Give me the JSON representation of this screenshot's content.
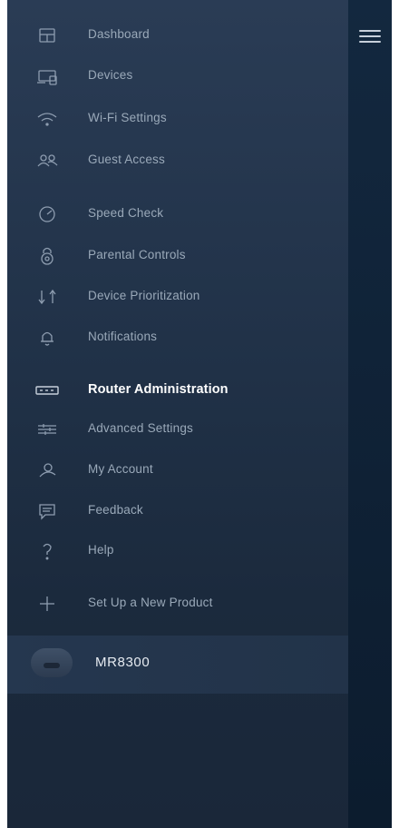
{
  "menu": {
    "items": [
      {
        "label": "Dashboard",
        "icon": "dashboard-icon"
      },
      {
        "label": "Devices",
        "icon": "devices-icon"
      },
      {
        "label": "Wi-Fi Settings",
        "icon": "wifi-icon"
      },
      {
        "label": "Guest Access",
        "icon": "guest-access-icon"
      },
      {
        "label": "Speed Check",
        "icon": "speedometer-icon"
      },
      {
        "label": "Parental Controls",
        "icon": "lock-icon"
      },
      {
        "label": "Device Prioritization",
        "icon": "priority-arrows-icon"
      },
      {
        "label": "Notifications",
        "icon": "bell-icon"
      },
      {
        "label": "Router Administration",
        "icon": "router-icon",
        "active": true
      },
      {
        "label": "Advanced Settings",
        "icon": "sliders-icon"
      },
      {
        "label": "My Account",
        "icon": "account-icon"
      },
      {
        "label": "Feedback",
        "icon": "feedback-icon"
      },
      {
        "label": "Help",
        "icon": "help-icon"
      },
      {
        "label": "Set Up a New Product",
        "icon": "plus-icon"
      }
    ]
  },
  "device": {
    "name": "MR8300",
    "icon": "router-thumbnail"
  },
  "header": {
    "menu_icon": "hamburger-menu-icon"
  },
  "colors": {
    "drawer": "#24364d",
    "background": "#0b1a2c",
    "active_text": "#ffffff",
    "inactive_text": "#9aa9b9"
  }
}
